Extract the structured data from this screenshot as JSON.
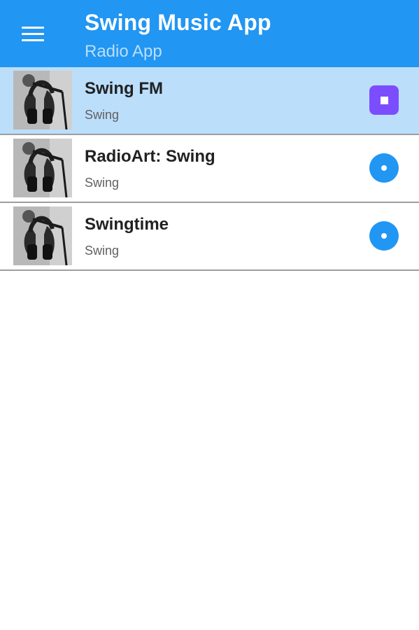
{
  "header": {
    "title": "Swing Music App",
    "subtitle": "Radio App",
    "menu_icon": "hamburger-menu-icon",
    "color": "#2196F3",
    "subtitle_color": "#BBDEFB"
  },
  "stations": [
    {
      "name": "Swing FM",
      "genre": "Swing",
      "state": "playing",
      "action_icon": "stop-icon"
    },
    {
      "name": "RadioArt: Swing",
      "genre": "Swing",
      "state": "idle",
      "action_icon": "play-icon"
    },
    {
      "name": "Swingtime",
      "genre": "Swing",
      "state": "idle",
      "action_icon": "play-icon"
    }
  ],
  "colors": {
    "active_row": "#BBDEFB",
    "stop_button": "#7C4DFF",
    "play_button": "#2196F3"
  }
}
